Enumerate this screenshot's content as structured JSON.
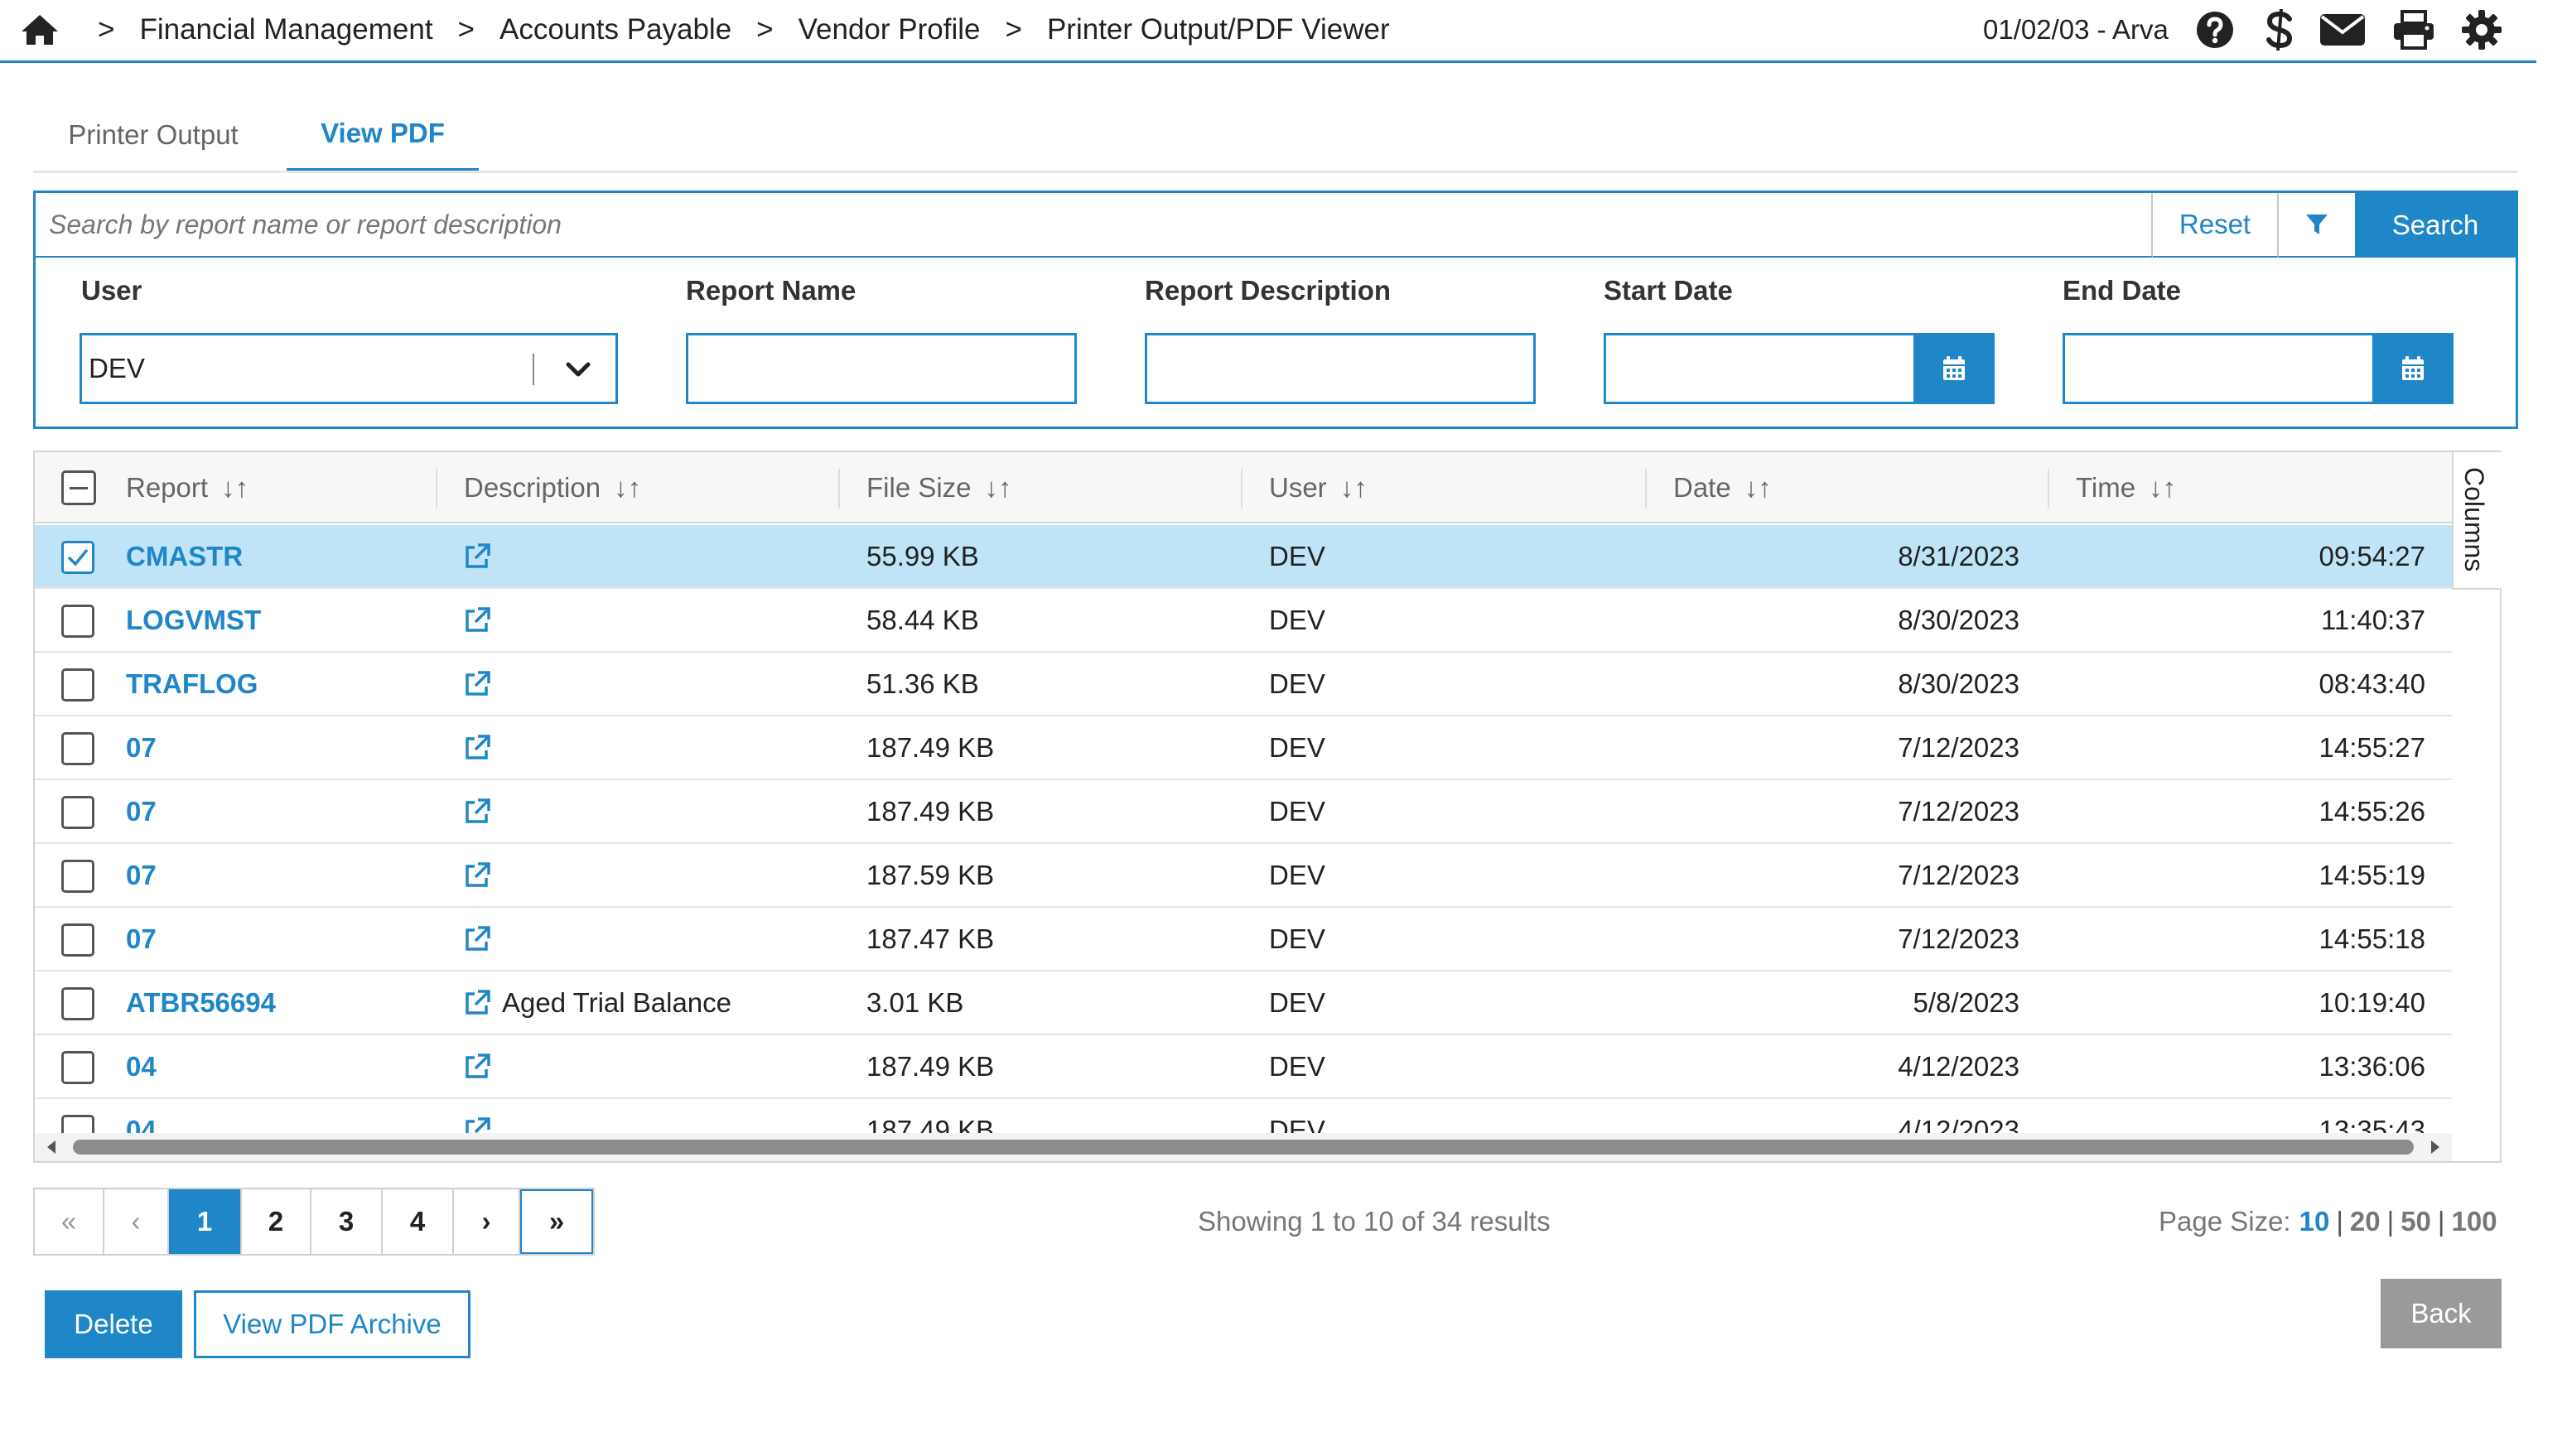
{
  "header": {
    "breadcrumbs": [
      "Financial Management",
      "Accounts Payable",
      "Vendor Profile",
      "Printer Output/PDF Viewer"
    ],
    "separator": ">",
    "date_user": "01/02/03 - Arva",
    "icons": [
      "home-icon",
      "help-icon",
      "dollar-s-icon",
      "mail-icon",
      "print-icon",
      "gear-icon"
    ]
  },
  "tabs": [
    {
      "label": "Printer Output",
      "active": false
    },
    {
      "label": "View PDF",
      "active": true
    }
  ],
  "search": {
    "placeholder": "Search by report name or report description",
    "value": "",
    "reset_label": "Reset",
    "search_label": "Search"
  },
  "filters": {
    "user_label": "User",
    "user_value": "DEV",
    "report_name_label": "Report Name",
    "report_description_label": "Report Description",
    "start_date_label": "Start Date",
    "end_date_label": "End Date"
  },
  "table": {
    "columns": [
      "Report",
      "Description",
      "File Size",
      "User",
      "Date",
      "Time"
    ],
    "columns_toggle_label": "Columns",
    "rows": [
      {
        "report": "CMASTR",
        "description": "",
        "size": "55.99 KB",
        "user": "DEV",
        "date": "8/31/2023",
        "time": "09:54:27",
        "selected": true
      },
      {
        "report": "LOGVMST",
        "description": "",
        "size": "58.44 KB",
        "user": "DEV",
        "date": "8/30/2023",
        "time": "11:40:37",
        "selected": false
      },
      {
        "report": "TRAFLOG",
        "description": "",
        "size": "51.36 KB",
        "user": "DEV",
        "date": "8/30/2023",
        "time": "08:43:40",
        "selected": false
      },
      {
        "report": "07",
        "description": "",
        "size": "187.49 KB",
        "user": "DEV",
        "date": "7/12/2023",
        "time": "14:55:27",
        "selected": false
      },
      {
        "report": "07",
        "description": "",
        "size": "187.49 KB",
        "user": "DEV",
        "date": "7/12/2023",
        "time": "14:55:26",
        "selected": false
      },
      {
        "report": "07",
        "description": "",
        "size": "187.59 KB",
        "user": "DEV",
        "date": "7/12/2023",
        "time": "14:55:19",
        "selected": false
      },
      {
        "report": "07",
        "description": "",
        "size": "187.47 KB",
        "user": "DEV",
        "date": "7/12/2023",
        "time": "14:55:18",
        "selected": false
      },
      {
        "report": "ATBR56694",
        "description": "Aged Trial Balance",
        "size": "3.01 KB",
        "user": "DEV",
        "date": "5/8/2023",
        "time": "10:19:40",
        "selected": false
      },
      {
        "report": "04",
        "description": "",
        "size": "187.49 KB",
        "user": "DEV",
        "date": "4/12/2023",
        "time": "13:36:06",
        "selected": false
      },
      {
        "report": "04",
        "description": "",
        "size": "187.49 KB",
        "user": "DEV",
        "date": "4/12/2023",
        "time": "13:35:43",
        "selected": false
      }
    ]
  },
  "pagination": {
    "first": "«",
    "prev": "‹",
    "pages": [
      "1",
      "2",
      "3",
      "4"
    ],
    "current": "1",
    "next": "›",
    "last": "»",
    "showing_text": "Showing 1 to 10 of 34 results",
    "page_size_label": "Page Size:",
    "page_sizes": [
      "10",
      "20",
      "50",
      "100"
    ],
    "page_size_selected": "10"
  },
  "actions": {
    "delete_label": "Delete",
    "view_archive_label": "View PDF Archive",
    "back_label": "Back"
  },
  "colors": {
    "accent": "#1f86c8",
    "selected_row": "#bfe4f8",
    "back_button": "#9a9a9a"
  }
}
